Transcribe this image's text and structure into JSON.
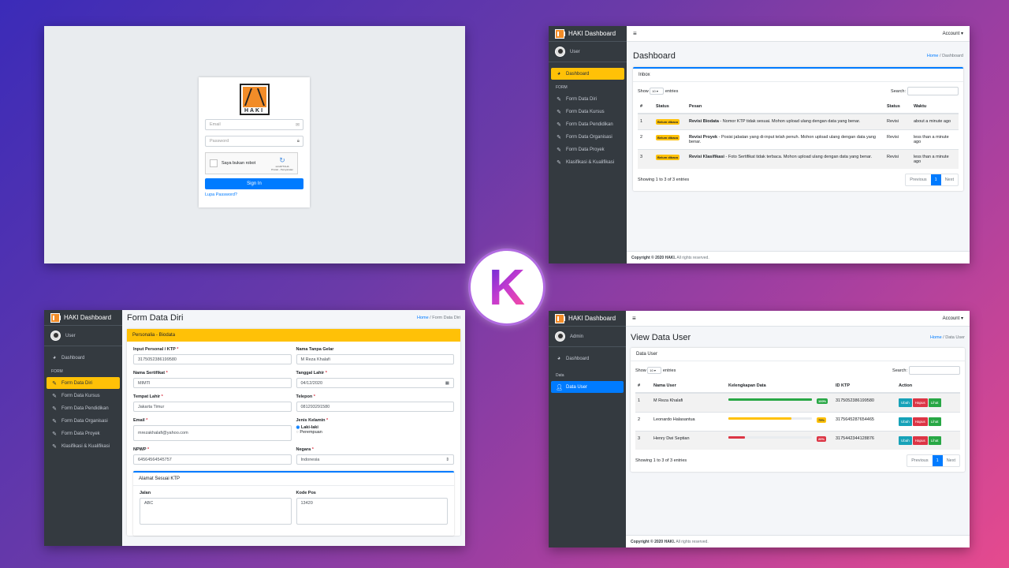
{
  "login": {
    "logo_text": "HAKI",
    "email_placeholder": "Email",
    "password_placeholder": "Password",
    "captcha_label": "Saya bukan robot",
    "captcha_brand": "reCAPTCHA",
    "captcha_links": "Privasi - Persyaratan",
    "signin": "Sign In",
    "forgot": "Lupa Password?"
  },
  "dashboard": {
    "brand": "HAKI Dashboard",
    "user": "User",
    "account": "Account",
    "nav_dashboard": "Dashboard",
    "form_header": "FORM",
    "nav": [
      "Form Data Diri",
      "Form Data Kursus",
      "Form Data Pendidikan",
      "Form Data Organisasi",
      "Form Data Proyek",
      "Klasifikasi & Kualifikasi"
    ],
    "title": "Dashboard",
    "breadcrumb_home": "Home",
    "breadcrumb_current": "Dashboard",
    "card_title": "Inbox",
    "show": "Show",
    "entries_value": "10",
    "entries": "entries",
    "search": "Search:",
    "columns": [
      "#",
      "Status",
      "Pesan",
      "Status",
      "Waktu"
    ],
    "rows": [
      {
        "no": "1",
        "status": "Belum dibaca",
        "subject": "Revisi Biodata",
        "msg": " - Nomor KTP tidak sesuai. Mohon upload ulang dengan data yang benar.",
        "type": "Revisi",
        "time": "about a minute ago"
      },
      {
        "no": "2",
        "status": "Belum dibaca",
        "subject": "Revisi Proyek",
        "msg": " - Posisi jabatan yang di-input telah penuh. Mohon upload ulang dengan data yang benar.",
        "type": "Revisi",
        "time": "less than a minute ago"
      },
      {
        "no": "3",
        "status": "Belum dibaca",
        "subject": "Revisi Klasifikasi",
        "msg": " - Foto Sertifikat tidak terbaca. Mohon upload ulang dengan data yang benar.",
        "type": "Revisi",
        "time": "less than a minute ago"
      }
    ],
    "showing": "Showing 1 to 3 of 3 entries",
    "prev": "Previous",
    "page": "1",
    "next": "Next",
    "copyright": "Copyright © 2020 HAKI.",
    "rights": " All rights reserved."
  },
  "form": {
    "brand": "HAKI Dashboard",
    "user": "User",
    "nav_dashboard": "Dashboard",
    "form_header": "FORM",
    "nav": [
      "Form Data Diri",
      "Form Data Kursus",
      "Form Data Pendidikan",
      "Form Data Organisasi",
      "Form Data Proyek",
      "Klasifikasi & Kualifikasi"
    ],
    "title": "Form Data Diri",
    "breadcrumb_home": "Home",
    "breadcrumb_current": "Form Data Diri",
    "card_title": "Personalia - Biodata",
    "ktp_label": "Input Personal / KTP",
    "ktp_value": "3175052386199580",
    "gelar_label": "Nama Tanpa Gelar",
    "gelar_value": "M Reza Khalafi",
    "sert_label": "Nama Sertifikat",
    "sert_value": "MIMTI",
    "tgl_label": "Tanggal Lahir",
    "tgl_value": "04/12/2020",
    "tempat_label": "Tempat Lahir",
    "tempat_value": "Jakarta Timur",
    "telp_label": "Telepon",
    "telp_value": "081293291580",
    "email_label": "Email",
    "email_value": "mrezakhalafi@yahoo.com",
    "jk_label": "Jenis Kelamin",
    "jk_opt1": "Laki-laki",
    "jk_opt2": "Perempuan",
    "npwp_label": "NPWP",
    "npwp_value": "64564564545757",
    "negara_label": "Negara",
    "negara_value": "Indonesia",
    "alamat_title": "Alamat Sesuai KTP",
    "jalan_label": "Jalan",
    "jalan_value": "ABC",
    "kodepos_label": "Kode Pos",
    "kodepos_value": "13420"
  },
  "users": {
    "brand": "HAKI Dashboard",
    "user": "Admin",
    "account": "Account",
    "nav_dashboard": "Dashboard",
    "data_header": "Data",
    "nav_data_user": "Data User",
    "title": "View Data User",
    "breadcrumb_home": "Home",
    "breadcrumb_current": "Data User",
    "card_title": "Data User",
    "show": "Show",
    "entries_value": "10",
    "entries": "entries",
    "search": "Search:",
    "columns": [
      "#",
      "Nama User",
      "Kelengkapan Data",
      "",
      "ID KTP",
      "Action"
    ],
    "rows": [
      {
        "no": "1",
        "name": "M Reza Khalafi",
        "pct_label": "100%",
        "pct": 1.0,
        "color": "#28a745",
        "ktp": "3175052386199580"
      },
      {
        "no": "2",
        "name": "Leonardo Halasantua",
        "pct_label": "75%",
        "pct": 0.75,
        "color": "#ffc107",
        "ktp": "3175645287654465"
      },
      {
        "no": "3",
        "name": "Henry Dwi Septian",
        "pct_label": "20%",
        "pct": 0.2,
        "color": "#dc3545",
        "ktp": "3175442344128876"
      }
    ],
    "btn_ubah": "Ubah",
    "btn_hapus": "Hapus",
    "btn_lihat": "Lihat",
    "showing": "Showing 1 to 3 of 3 entries",
    "prev": "Previous",
    "page": "1",
    "next": "Next",
    "copyright": "Copyright © 2020 HAKI.",
    "rights": " All rights reserved."
  },
  "center_logo_letter": "K"
}
